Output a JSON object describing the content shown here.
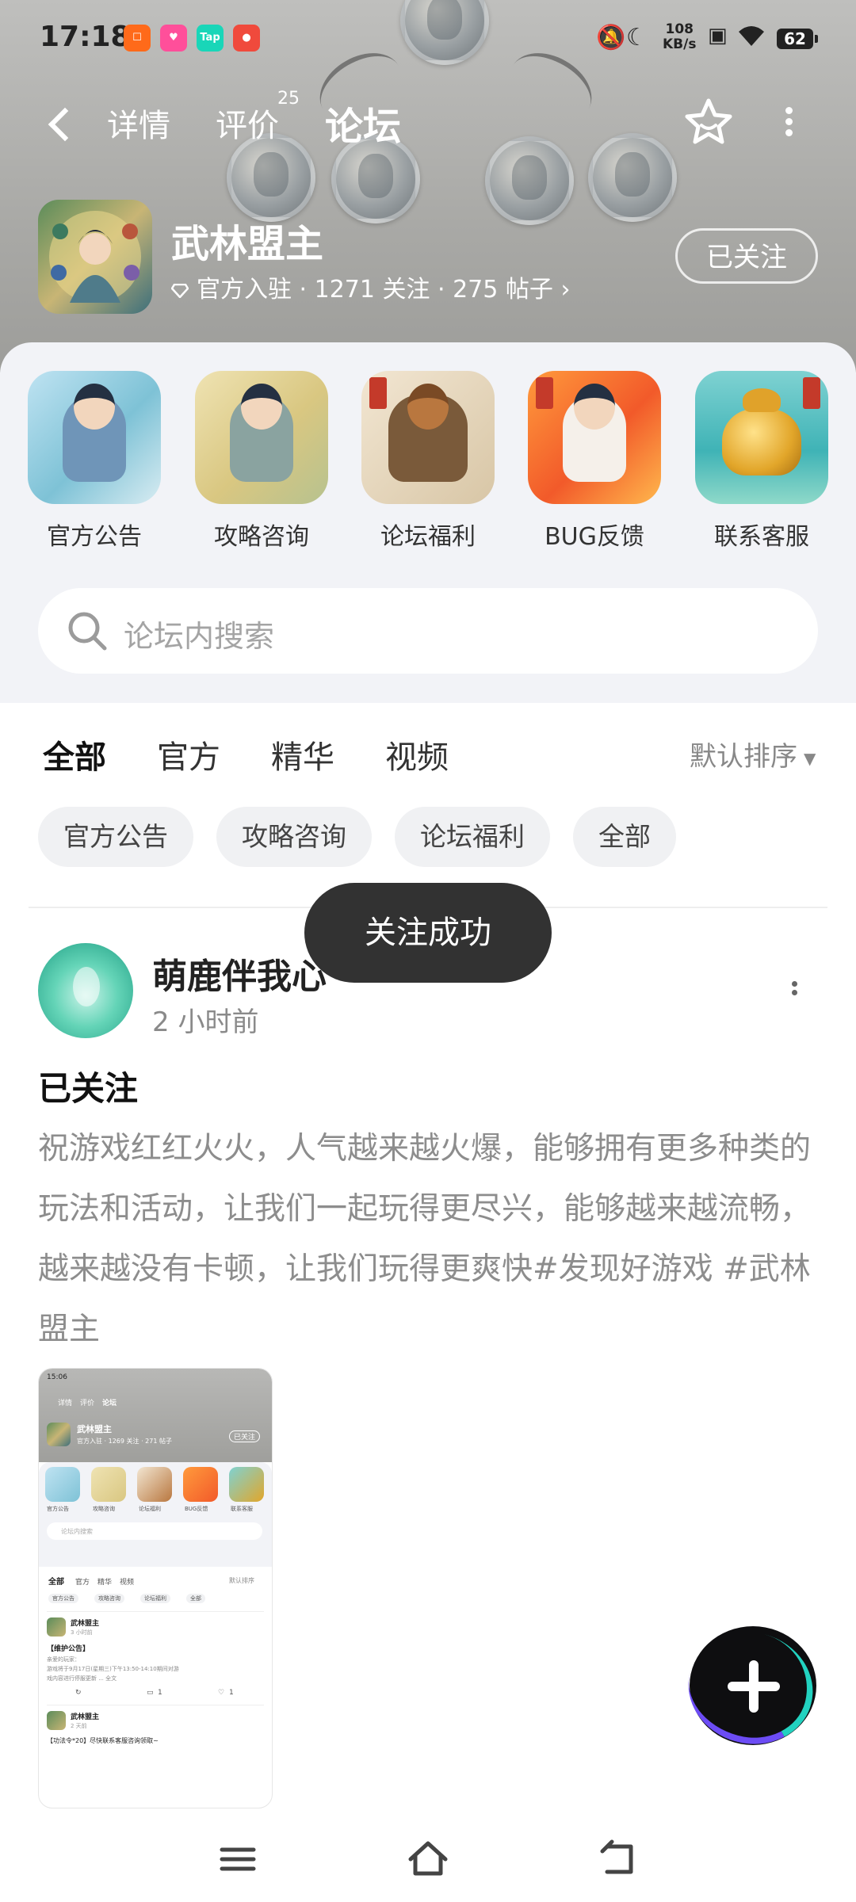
{
  "status_bar": {
    "time": "17:18",
    "net_speed_value": "108",
    "net_speed_unit": "KB/s",
    "battery": "62",
    "notification_icons": [
      "app-icon-orange",
      "app-icon-pink",
      "app-icon-taptap",
      "app-icon-red"
    ]
  },
  "top_nav": {
    "tabs": [
      {
        "label": "详情"
      },
      {
        "label": "评价"
      },
      {
        "label": "论坛"
      }
    ],
    "review_count": "25",
    "active_tab": "论坛"
  },
  "game": {
    "name": "武林盟主",
    "meta": "官方入驻 · 1271 关注 · 275 帖子",
    "follow_label": "已关注"
  },
  "categories": [
    {
      "label": "官方公告"
    },
    {
      "label": "攻略咨询"
    },
    {
      "label": "论坛福利"
    },
    {
      "label": "BUG反馈"
    },
    {
      "label": "联系客服"
    }
  ],
  "search": {
    "placeholder": "论坛内搜索"
  },
  "feed_tabs": [
    {
      "label": "全部"
    },
    {
      "label": "官方"
    },
    {
      "label": "精华"
    },
    {
      "label": "视频"
    }
  ],
  "sort_label": "默认排序",
  "chips": [
    {
      "label": "官方公告"
    },
    {
      "label": "攻略咨询"
    },
    {
      "label": "论坛福利"
    },
    {
      "label": "全部"
    }
  ],
  "toast": "关注成功",
  "post": {
    "author": "萌鹿伴我心",
    "time_ago": "2 小时前",
    "title": "已关注",
    "body": "祝游戏红红火火，人气越来越火爆，能够拥有更多种类的玩法和活动，让我们一起玩得更尽兴，能够越来越流畅，越来越没有卡顿，让我们玩得更爽快#发现好游戏 #武林盟主"
  },
  "thumbnail": {
    "time": "15:06",
    "tabs": [
      "详情",
      "评价",
      "论坛"
    ],
    "game_name": "武林盟主",
    "meta": "官方入驻 · 1269 关注 · 271 帖子",
    "follow": "已关注",
    "cats": [
      "官方公告",
      "攻略咨询",
      "论坛福利",
      "BUG反馈",
      "联系客服"
    ],
    "search": "论坛内搜索",
    "feed_tabs": [
      "全部",
      "官方",
      "精华",
      "视频"
    ],
    "sort": "默认排序",
    "chips": [
      "官方公告",
      "攻略咨询",
      "论坛福利",
      "全部"
    ],
    "post1_author": "武林盟主",
    "post1_time": "3 小时前",
    "post1_title": "【维护公告】",
    "post1_line1": "亲爱的玩家：",
    "post1_line2": "游戏将于9月17日(星期三)下午13:50-14:10期间对游",
    "post1_line3": "戏内容进行停服更新 ... 全文",
    "post1_comments": "1",
    "post1_likes": "1",
    "post2_author": "武林盟主",
    "post2_time": "2 天前",
    "post2_title": "【功法令*20】尽快联系客服咨询领取~"
  },
  "colors": {
    "accent": "#19d6b8",
    "fab": "#0e0e10",
    "toast_bg": "#323232"
  }
}
